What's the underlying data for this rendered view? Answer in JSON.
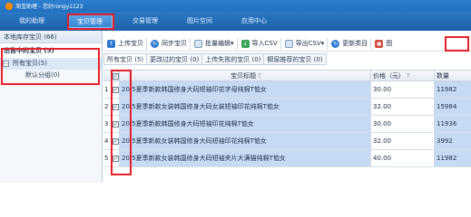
{
  "app": {
    "title": "淘宝助理 - 您好rongy1123"
  },
  "nav": {
    "tabs": [
      "我的助理",
      "宝贝管理",
      "交易管理",
      "图片空间",
      "应用中心"
    ],
    "active": 1
  },
  "sidebar": {
    "header": "本地库存宝贝 (66)",
    "selected": "出售中的宝贝 (5)",
    "items": [
      {
        "label": "所有宝贝(5)"
      },
      {
        "label": "默认分组(0)"
      }
    ]
  },
  "toolbar": {
    "buttons": [
      {
        "label": "上传宝贝",
        "icon": "upload-icon"
      },
      {
        "label": "同步宝贝",
        "icon": "sync-icon"
      },
      {
        "label": "批量编辑",
        "icon": "batch-edit-icon",
        "dropdown": "▾"
      },
      {
        "label": "导入CSV",
        "icon": "import-csv-icon"
      },
      {
        "label": "导出CSV",
        "icon": "export-csv-icon",
        "dropdown": "▾"
      },
      {
        "label": "更新类目",
        "icon": "update-category-icon"
      },
      {
        "label": "图",
        "icon": "image-icon"
      }
    ]
  },
  "subtabs": [
    "所有宝贝 (5)",
    "更改过的宝贝 (0)",
    "上传失败的宝贝 (0)",
    "橱窗推荐的宝贝 (0)"
  ],
  "table": {
    "header_check": "✓",
    "columns": {
      "title": "宝贝标题",
      "price": "价格（元）",
      "qty": "数量"
    },
    "sort_mark": "T",
    "rows": [
      {
        "num": "1",
        "check": "✓",
        "title": "20.5夏季新款韩国修身大码短袖印花字母纯棉T恤女",
        "price": "30.00",
        "qty": "11982"
      },
      {
        "num": "2",
        "check": "✓",
        "title": "20.5夏季新款女装韩国修身大码女装短袖印花纯棉T恤女",
        "price": "32.00",
        "qty": "15984"
      },
      {
        "num": "3",
        "check": "✓",
        "title": "20.5夏季新款韩国修身大码短袖印花纯棉T恤女",
        "price": "30.00",
        "qty": "11936"
      },
      {
        "num": "4",
        "check": "✓",
        "title": "20.5夏季新款女装韩国修身大码短袖印花纯棉T恤女",
        "price": "32.00",
        "qty": "3992"
      },
      {
        "num": "5",
        "check": "✓",
        "title": "20.5夏季新款女装韩国修身大码短袖夹片大满猫纯棉T恤女",
        "price": "40.00",
        "qty": "11982"
      }
    ]
  },
  "colors": {
    "nav": "#1d62a8",
    "highlight": "#e5202a",
    "selected_row": "#c6dbf3"
  }
}
